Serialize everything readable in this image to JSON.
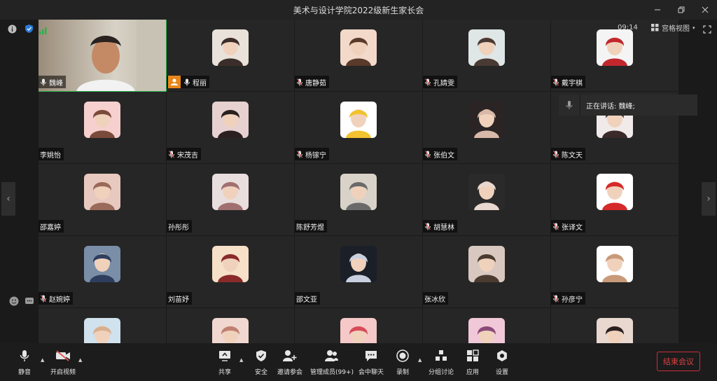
{
  "window": {
    "title": "美术与设计学院2022级新生家长会"
  },
  "status": {
    "time": "09:14",
    "view_label": "宫格视图",
    "speaking_label": "正在讲话: 魏峰;"
  },
  "colors": {
    "active_border": "#2bb34a",
    "host_badge": "#e8861a",
    "end_button": "#e04040",
    "muted_mic": "#e0524e"
  },
  "participants": [
    {
      "name": "魏峰",
      "mic": "on",
      "video": true
    },
    {
      "name": "程丽",
      "mic": "on",
      "host": true
    },
    {
      "name": "唐静茹",
      "mic": "muted"
    },
    {
      "name": "孔婧雯",
      "mic": "muted"
    },
    {
      "name": "戴宇棋",
      "mic": "muted"
    },
    {
      "name": "李姚怡",
      "mic": "none"
    },
    {
      "name": "宋茂吉",
      "mic": "muted"
    },
    {
      "name": "杨镓宁",
      "mic": "muted"
    },
    {
      "name": "张伯文",
      "mic": "muted"
    },
    {
      "name": "陈文天",
      "mic": "muted"
    },
    {
      "name": "邵嘉婷",
      "mic": "none"
    },
    {
      "name": "孙彤彤",
      "mic": "none"
    },
    {
      "name": "陈舒芳煜",
      "mic": "none"
    },
    {
      "name": "胡慧林",
      "mic": "muted"
    },
    {
      "name": "张译文",
      "mic": "muted"
    },
    {
      "name": "赵婉婷",
      "mic": "muted"
    },
    {
      "name": "刘苗妤",
      "mic": "none"
    },
    {
      "name": "邵文亚",
      "mic": "none"
    },
    {
      "name": "张冰欣",
      "mic": "none"
    },
    {
      "name": "孙彦宁",
      "mic": "muted"
    },
    {
      "name": "",
      "mic": "none"
    },
    {
      "name": "",
      "mic": "none"
    },
    {
      "name": "",
      "mic": "none"
    },
    {
      "name": "",
      "mic": "none"
    },
    {
      "name": "",
      "mic": "none"
    }
  ],
  "toolbar": {
    "mute": "静音",
    "video": "开启视频",
    "share": "共享",
    "security": "安全",
    "invite": "邀请参会",
    "participants": "管理成员(99+)",
    "chat": "会中聊天",
    "record": "录制",
    "breakout": "分组讨论",
    "apps": "应用",
    "settings": "设置",
    "end": "结束会议"
  }
}
